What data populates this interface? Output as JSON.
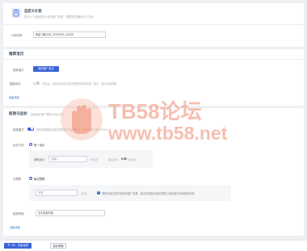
{
  "header": {
    "title": "自定义计划",
    "desc": "您在以下设置创作计划的推广渠道，需要提前准备好以下信息"
  },
  "plan": {
    "name_label": "计划名称",
    "name_value": "新建飞聚计划_20230919_115430"
  },
  "product": {
    "section_title": "推荐宝贝",
    "select_label": "选择宝贝",
    "select_button": "添加推广宝贝",
    "smart_label": "智能优化",
    "smart_text": "开启后，系统将自动为您匹配更多相关的推广宝贝，提升流量获取",
    "more_link": "高级设置"
  },
  "budget": {
    "section_title": "投放与出价",
    "section_sub": "设置每日推广预算与出价方式",
    "mode_label": "投放模式",
    "mode_text": "系统将根据您设置的预算进行智能投放，每日预算上限为100%",
    "bid_label": "出价方式",
    "bid_option": "统一出价",
    "bid_field_label": "基础出价",
    "bid_placeholder": "请输入",
    "bid_unit": "元/点击",
    "bid_suggest_label": "建议出价",
    "bid_suggest_value": "0.55",
    "bid_suggest_unit": "元/点击",
    "daily_label": "日预算",
    "daily_option": "每日预算",
    "daily_placeholder": "不限",
    "daily_unit": "元/天",
    "daily_tip": "预算设置过低可能影响推广效果，建议您设置合适的预算以保证宝贝持续获得流量",
    "period_label": "投放时段",
    "period_value": "全天投放时段",
    "more_link": "高级设置"
  },
  "watermark": {
    "brand": "TB58论坛",
    "url": "www.tb58.net"
  },
  "footer": {
    "next_button": "下一步，完善创意",
    "save_button": "保存草稿"
  }
}
